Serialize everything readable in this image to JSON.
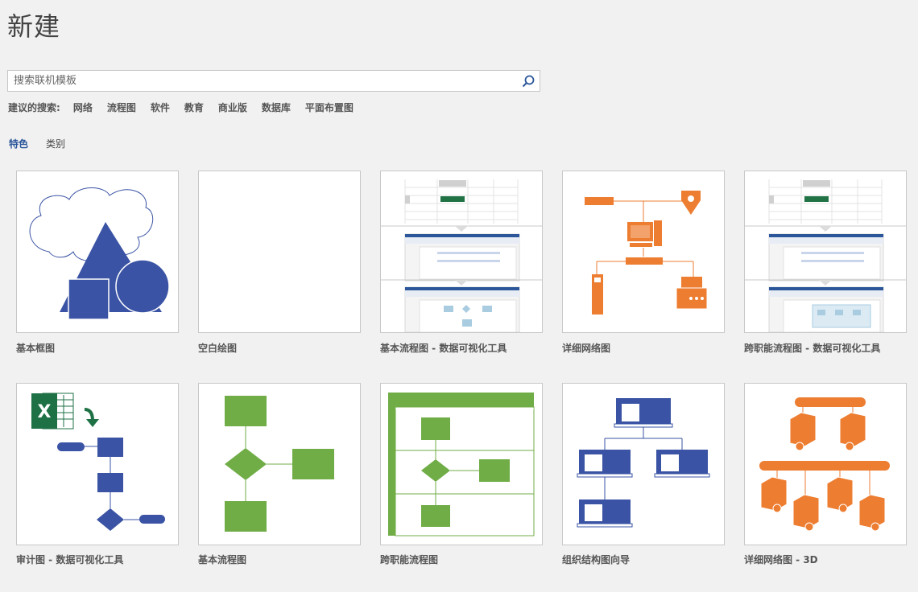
{
  "header": {
    "title": "新建"
  },
  "search": {
    "placeholder": "搜索联机模板",
    "icon": "search-icon"
  },
  "suggestions": {
    "label": "建议的搜索:",
    "items": [
      "网络",
      "流程图",
      "软件",
      "教育",
      "商业版",
      "数据库",
      "平面布置图"
    ]
  },
  "tabs": [
    {
      "label": "特色",
      "active": true
    },
    {
      "label": "类别",
      "active": false
    }
  ],
  "templates": [
    {
      "name": "基本框图"
    },
    {
      "name": "空白绘图"
    },
    {
      "name": "基本流程图 - 数据可视化工具"
    },
    {
      "name": "详细网络图"
    },
    {
      "name": "跨职能流程图 - 数据可视化工具"
    },
    {
      "name": "审计图 - 数据可视化工具"
    },
    {
      "name": "基本流程图"
    },
    {
      "name": "跨职能流程图"
    },
    {
      "name": "组织结构图向导"
    },
    {
      "name": "详细网络图 - 3D"
    }
  ],
  "thumbnail_labels": {
    "excel_letter": "X"
  },
  "colors": {
    "accent": "#2b579a",
    "blue_shape": "#3a53a4",
    "green_shape": "#70ad47",
    "orange_shape": "#ed7d31",
    "excel_green": "#1e7145"
  }
}
